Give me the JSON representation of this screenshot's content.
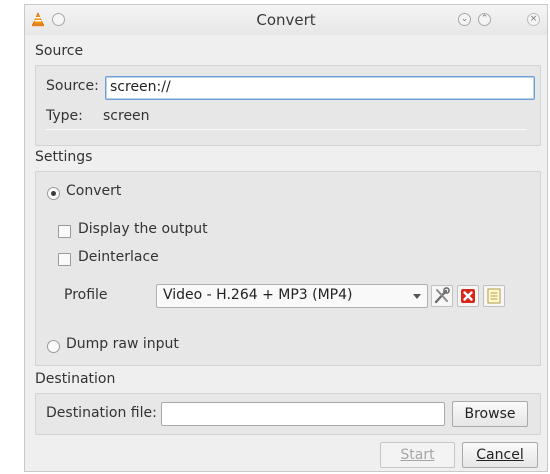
{
  "window": {
    "title": "Convert"
  },
  "source": {
    "section_title": "Source",
    "source_label": "Source:",
    "source_value": "screen://",
    "type_label": "Type:",
    "type_value": "screen"
  },
  "settings": {
    "section_title": "Settings",
    "convert_label": "Convert",
    "convert_selected": true,
    "display_output_label": "Display the output",
    "display_output_checked": false,
    "deinterlace_label": "Deinterlace",
    "deinterlace_checked": false,
    "profile_label": "Profile",
    "profile_value": "Video - H.264 + MP3 (MP4)",
    "dump_raw_label": "Dump raw input",
    "dump_raw_selected": false
  },
  "destination": {
    "section_title": "Destination",
    "file_label": "Destination file:",
    "file_value": "",
    "browse_label": "Browse"
  },
  "actions": {
    "start_label": "Start",
    "cancel_label": "Cancel"
  },
  "colors": {
    "accent": "#e67e22",
    "delete": "#d9261c",
    "focus": "#6b9fd6"
  },
  "icons": [
    "vlc-cone-icon",
    "minimize-icon",
    "maximize-icon",
    "close-icon",
    "edit-profile-icon",
    "delete-profile-icon",
    "new-profile-icon",
    "dropdown-arrow-icon"
  ]
}
